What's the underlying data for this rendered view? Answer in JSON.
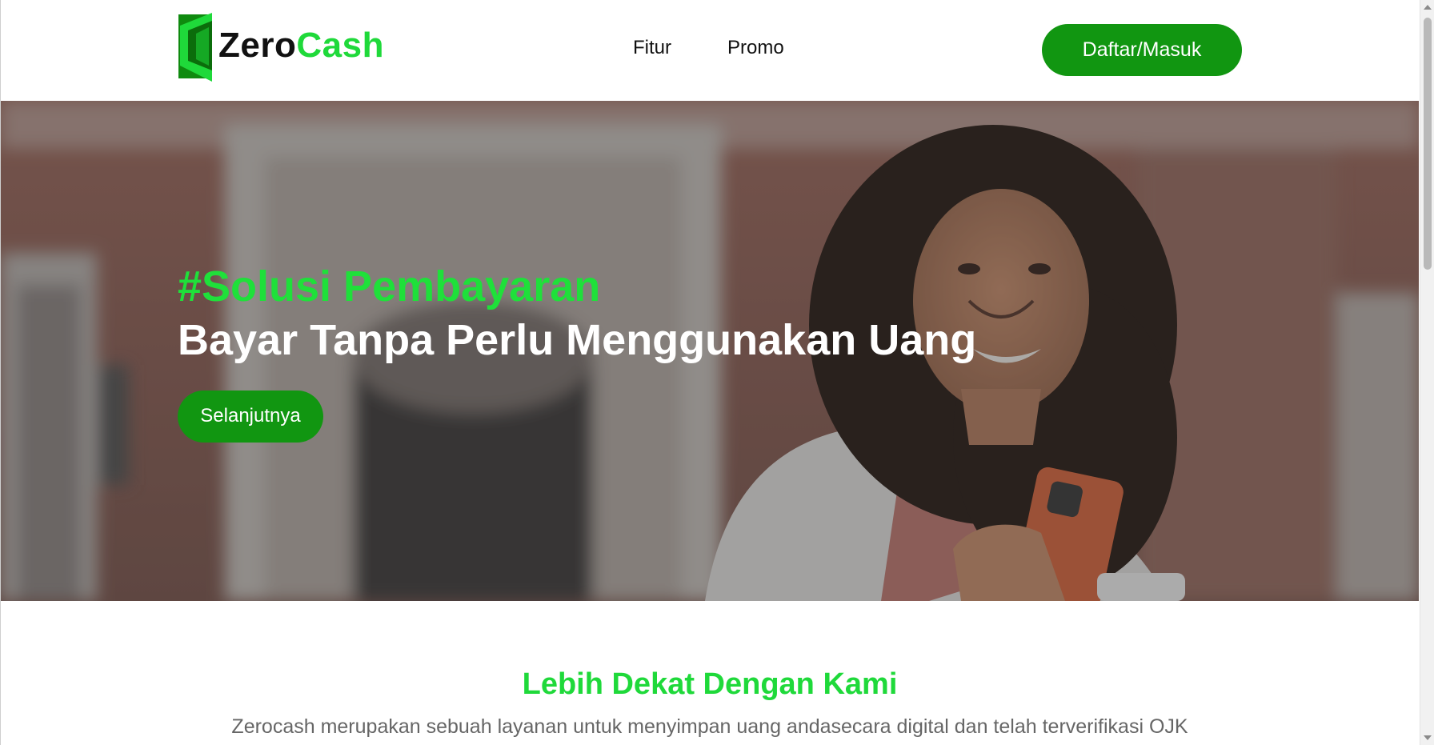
{
  "brand": {
    "name_part1": "Zero",
    "name_part2": "Cash",
    "logo_icon": "zerocash-logo-icon",
    "colors": {
      "brand_green": "#1fd93a",
      "button_green": "#119611"
    }
  },
  "nav": {
    "items": [
      {
        "label": "Fitur"
      },
      {
        "label": "Promo"
      }
    ],
    "cta_label": "Daftar/Masuk"
  },
  "hero": {
    "tagline": "#Solusi Pembayaran",
    "title": "Bayar Tanpa Perlu Menggunakan Uang",
    "button_label": "Selanjutnya",
    "image": "woman-smiling-holding-phone-photo"
  },
  "about": {
    "title": "Lebih Dekat Dengan Kami",
    "description": "Zerocash merupakan sebuah layanan untuk menyimpan uang andasecara digital dan telah terverifikasi OJK"
  }
}
